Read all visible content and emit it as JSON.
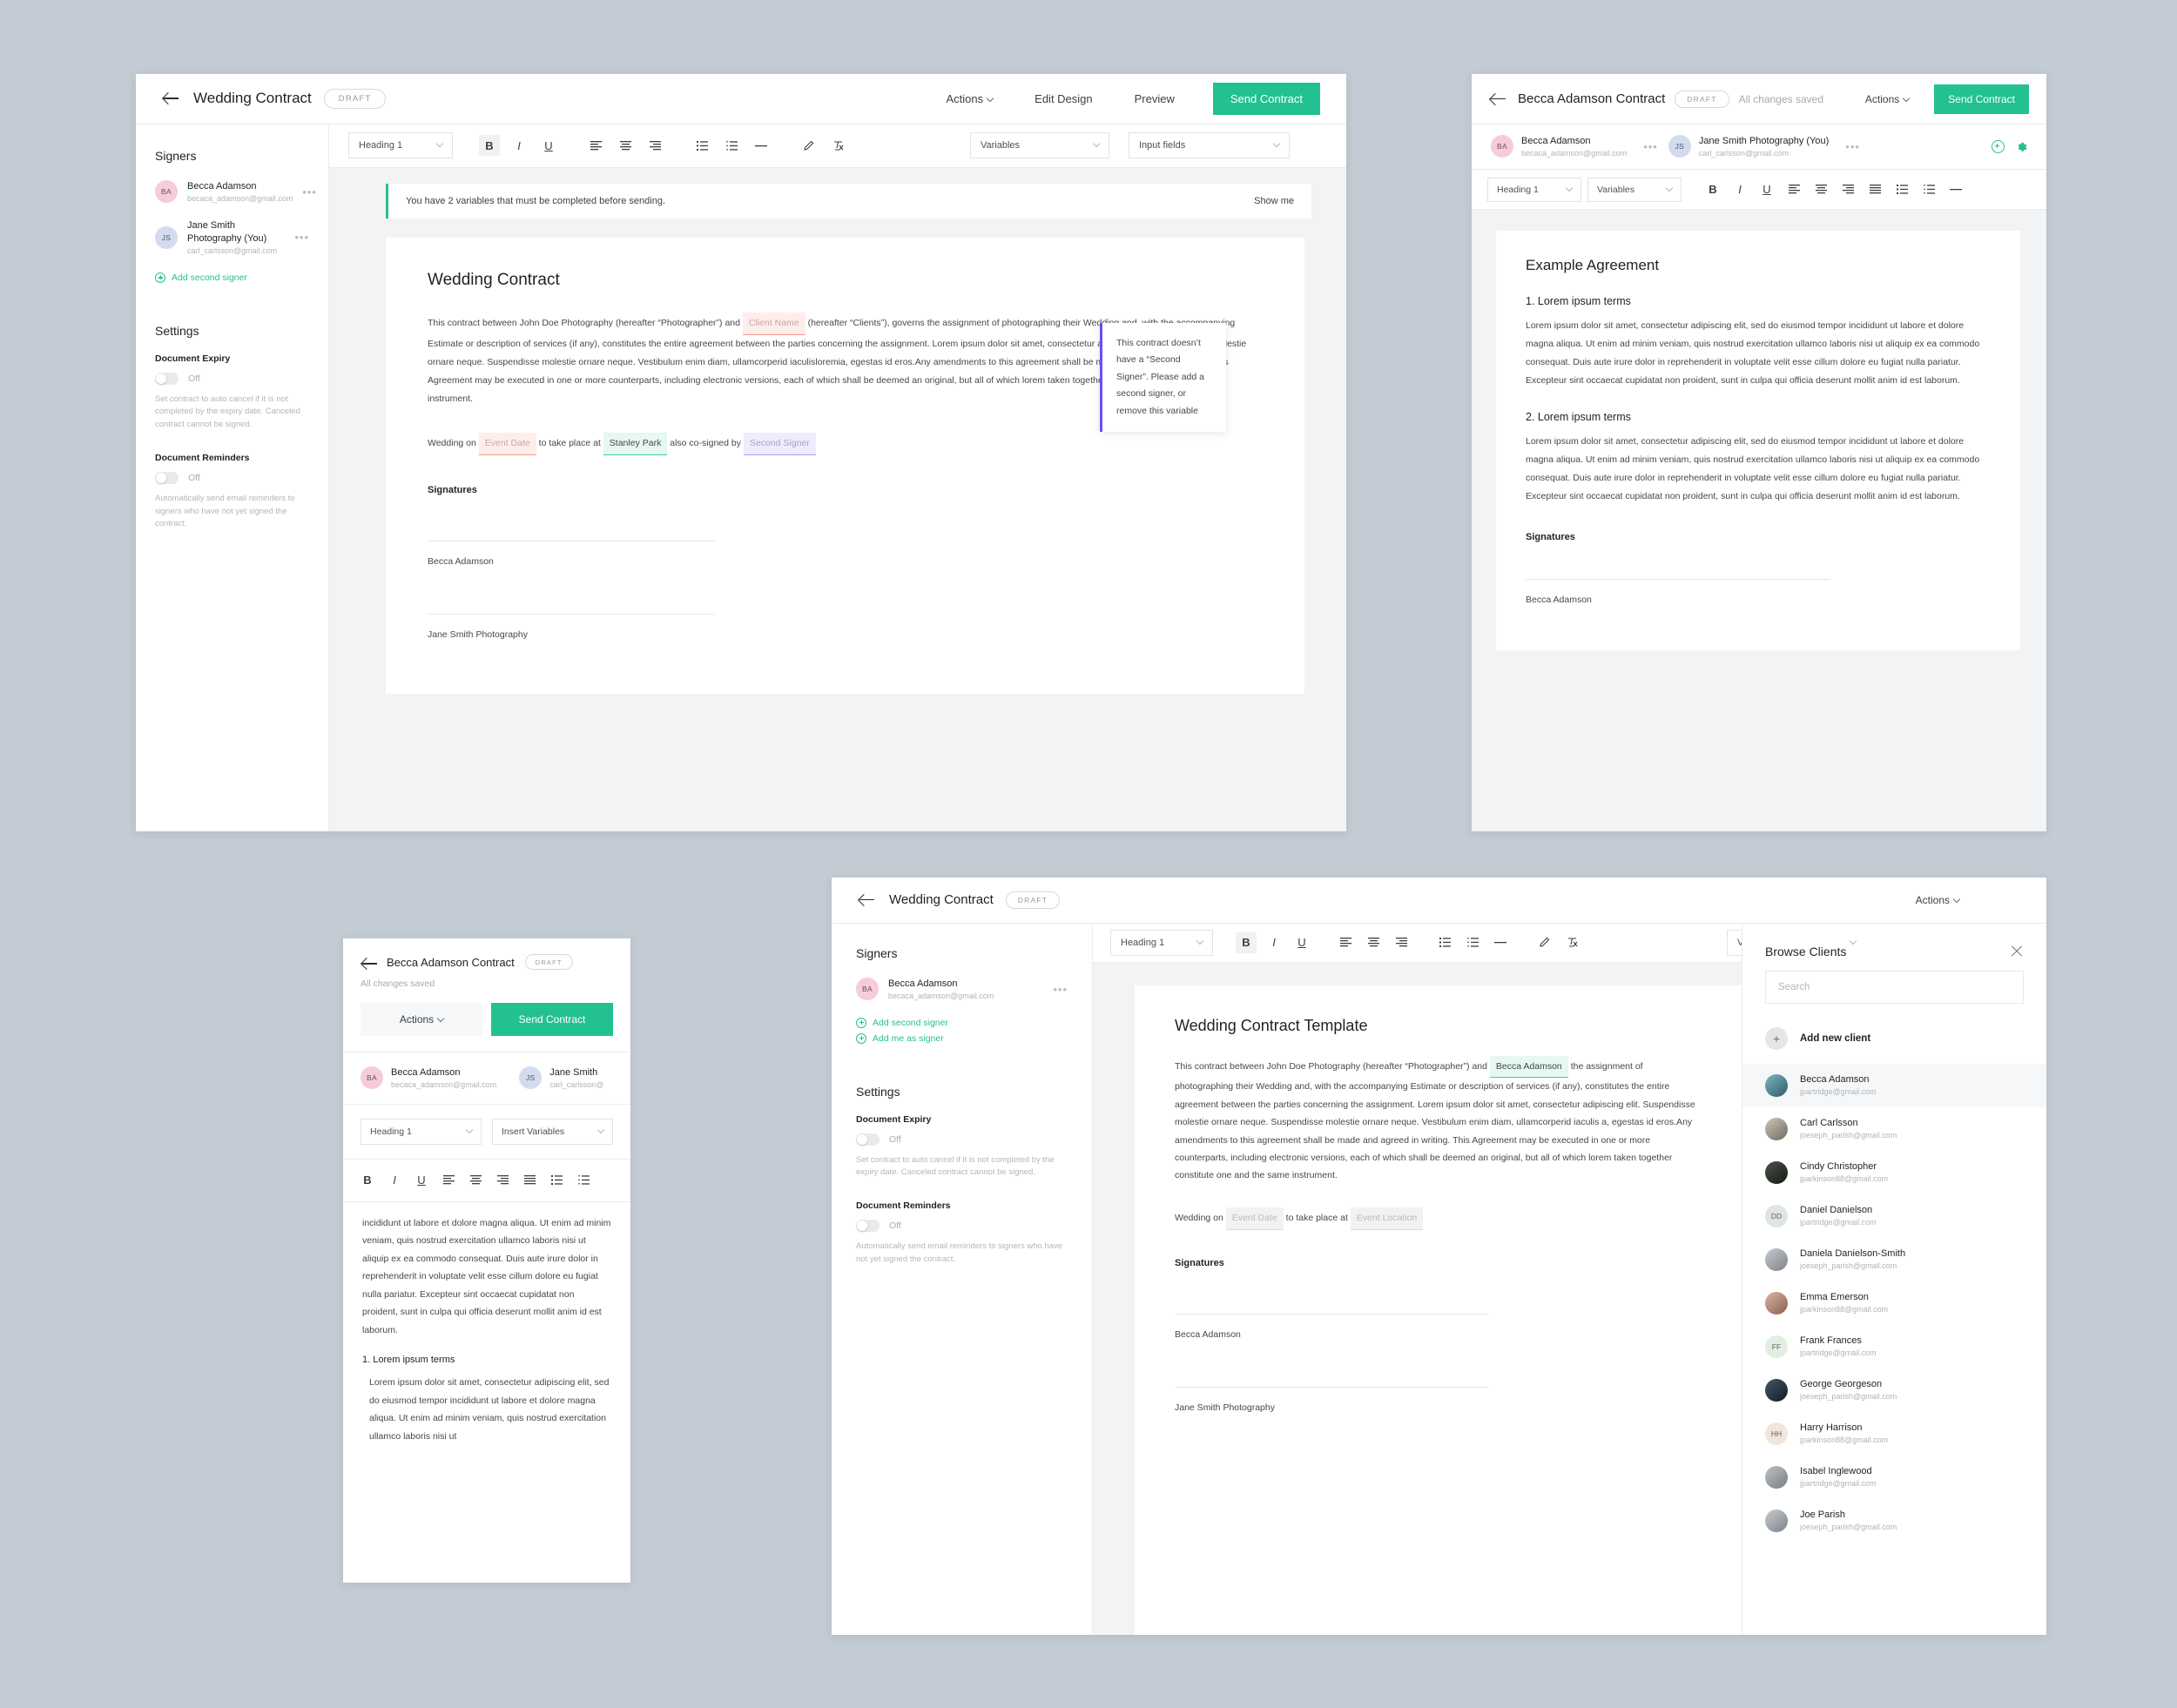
{
  "theme": {
    "accent": "#23c191",
    "page_bg": "#c3cbd4",
    "panel_bg": "#ffffff",
    "tooltip_accent": "#6b4ef5"
  },
  "panel1": {
    "header": {
      "title": "Wedding Contract",
      "status": "DRAFT",
      "actions_label": "Actions",
      "edit_design_label": "Edit Design",
      "preview_label": "Preview",
      "send_label": "Send Contract"
    },
    "sidebar": {
      "signers_heading": "Signers",
      "signers": [
        {
          "initials": "BA",
          "name": "Becca Adamson",
          "email": "becaca_adamson@gmail.com"
        },
        {
          "initials": "JS",
          "name": "Jane Smith Photography (You)",
          "email": "carl_carlsson@gmail.com"
        }
      ],
      "add_second_signer": "Add second signer",
      "settings_heading": "Settings",
      "document_expiry_label": "Document Expiry",
      "document_expiry_state": "Off",
      "document_expiry_desc": "Set contract to auto cancel if it is not completed by the expiry date. Canceled contract cannot be signed.",
      "document_reminders_label": "Document Reminders",
      "document_reminders_state": "Off",
      "document_reminders_desc": "Automatically send email reminders to signers who have not yet signed the contract."
    },
    "toolbar": {
      "heading_select": "Heading 1",
      "variables_select": "Variables",
      "input_fields_select": "Input fields"
    },
    "notice": {
      "text": "You have 2 variables that must be completed before sending.",
      "action": "Show me"
    },
    "doc": {
      "title": "Wedding Contract",
      "para_before_var": "This contract between John Doe Photography (hereafter “Photographer”) and",
      "var_client_name": "Client Name",
      "para_after_var": "(hereafter “Clients”), governs the assignment of photographing their Wedding and, with the accompanying Estimate or description of services (if any), constitutes the entire agreement between the parties concerning the assignment. Lorem ipsum dolor sit amet, consectetur adipiscing elit. Suspendisse molestie ornare neque.  Suspendisse molestie ornare neque. Vestibulum enim diam, ullamcorperid iaculisloremia, egestas id eros.Any amendments to this agreement shall be made and agreed in writing. This Agreement may be executed in one or more counterparts, including electronic versions, each of which shall be deemed an original, but all of which lorem taken together constitute one and the same instrument.",
      "wedding_prefix": "Wedding on",
      "var_event_date": "Event Date",
      "wedding_mid": "to take place at",
      "var_location": "Stanley Park",
      "wedding_suffix": "also co-signed by",
      "var_second_signer": "Second Signer",
      "signatures_heading": "Signatures",
      "sig1": "Becca Adamson",
      "sig2": "Jane Smith Photography"
    },
    "tooltip": "This contract doesn’t have a “Second Signer”. Please add a second signer, or remove this variable"
  },
  "panel2": {
    "header": {
      "title": "Becca Adamson Contract",
      "status": "DRAFT",
      "saved": "All changes saved",
      "actions_label": "Actions",
      "send_label": "Send Contract"
    },
    "signers": [
      {
        "initials": "BA",
        "name": "Becca Adamson",
        "email": "becaca_adamson@gmail.com"
      },
      {
        "initials": "JS",
        "name": "Jane Smith Photography (You)",
        "email": "carl_carlsson@gmail.com"
      }
    ],
    "toolbar": {
      "heading_select": "Heading 1",
      "variables_select": "Variables"
    },
    "doc": {
      "title": "Example Agreement",
      "section1_heading": "1. Lorem ipsum terms",
      "section1_body": "Lorem ipsum dolor sit amet, consectetur adipiscing elit, sed do eiusmod tempor incididunt ut labore et dolore magna aliqua. Ut enim ad minim veniam, quis nostrud exercitation ullamco laboris nisi ut aliquip ex ea commodo consequat. Duis aute irure dolor in reprehenderit in voluptate velit esse cillum dolore eu fugiat nulla pariatur. Excepteur sint occaecat cupidatat non proident, sunt in culpa qui officia deserunt mollit anim id est laborum.",
      "section2_heading": "2. Lorem ipsum terms",
      "section2_body": "Lorem ipsum dolor sit amet, consectetur adipiscing elit, sed do eiusmod tempor incididunt ut labore et dolore magna aliqua. Ut enim ad minim veniam, quis nostrud exercitation ullamco laboris nisi ut aliquip ex ea commodo consequat. Duis aute irure dolor in reprehenderit in voluptate velit esse cillum dolore eu fugiat nulla pariatur. Excepteur sint occaecat cupidatat non proident, sunt in culpa qui officia deserunt mollit anim id est laborum.",
      "signatures_heading": "Signatures",
      "sig1": "Becca Adamson"
    }
  },
  "panel3": {
    "header": {
      "title": "Becca Adamson Contract",
      "status": "DRAFT",
      "saved": "All changes saved"
    },
    "actions_label": "Actions",
    "send_label": "Send Contract",
    "signers": [
      {
        "initials": "BA",
        "name": "Becca Adamson",
        "email": "becaca_adamson@gmail.com"
      },
      {
        "initials": "JS",
        "name": "Jane Smith",
        "email": "carl_carlsson@"
      }
    ],
    "toolbar": {
      "heading_select": "Heading 1",
      "variables_select": "Insert Variables"
    },
    "doc": {
      "body_top": "incididunt ut labore et dolore magna aliqua. Ut enim ad minim veniam, quis nostrud exercitation ullamco laboris nisi ut aliquip ex ea commodo consequat. Duis aute irure dolor in reprehenderit in voluptate velit esse cillum dolore eu fugiat nulla pariatur. Excepteur sint occaecat cupidatat non proident, sunt in culpa qui officia deserunt mollit anim id est laborum.",
      "section1_heading": "1. Lorem ipsum terms",
      "section1_body": "Lorem ipsum dolor sit amet, consectetur adipiscing elit, sed do eiusmod tempor incididunt ut labore et dolore magna aliqua. Ut enim ad minim veniam, quis nostrud exercitation ullamco laboris nisi ut"
    }
  },
  "panel4": {
    "header": {
      "title": "Wedding Contract",
      "status": "DRAFT",
      "actions_label": "Actions"
    },
    "sidebar": {
      "signers_heading": "Signers",
      "signers": [
        {
          "initials": "BA",
          "name": "Becca Adamson",
          "email": "becaca_adamson@gmail.com"
        }
      ],
      "add_second_signer": "Add second signer",
      "add_me_as_signer": "Add me as signer",
      "settings_heading": "Settings",
      "document_expiry_label": "Document Expiry",
      "document_expiry_state": "Off",
      "document_expiry_desc": "Set contract to auto cancel if it is not completed by the expiry date. Canceled contract cannot be signed.",
      "document_reminders_label": "Document Reminders",
      "document_reminders_state": "Off",
      "document_reminders_desc": "Automatically send email reminders to signers who have not yet signed the contract."
    },
    "toolbar": {
      "heading_select": "Heading 1",
      "variables_select": "Variables"
    },
    "doc": {
      "title": "Wedding Contract Template",
      "para_before_var": "This contract between John Doe Photography (hereafter “Photographer”) and",
      "var_client_name": "Becca Adamson",
      "para_after_var": "the assignment of photographing their Wedding and, with the accompanying Estimate or description of services (if any), constitutes the entire agreement between the parties concerning the assignment. Lorem ipsum dolor sit amet, consectetur adipiscing elit. Suspendisse molestie ornare neque.  Suspendisse molestie ornare neque. Vestibulum enim diam, ullamcorperid iaculis a, egestas id eros.Any amendments to this agreement shall be made and agreed in writing. This Agreement may be executed in one or more counterparts, including electronic versions, each of which shall be deemed an original, but all of which lorem taken  together constitute one and the same instrument.",
      "wedding_prefix": "Wedding on",
      "var_event_date": "Event Date",
      "wedding_mid": "to take place at",
      "var_event_location": "Event Location",
      "signatures_heading": "Signatures",
      "sig1": "Becca Adamson",
      "sig2": "Jane Smith Photography"
    }
  },
  "browse_clients": {
    "title": "Browse Clients",
    "search_placeholder": "Search",
    "add_new_client": "Add new client",
    "clients": [
      {
        "name": "Becca Adamson",
        "email": "jpartridge@gmail.com",
        "initials": "",
        "photo": "teal",
        "selected": true
      },
      {
        "name": "Carl Carlsson",
        "email": "joeseph_parish@gmail.com",
        "initials": "",
        "photo": "warm",
        "selected": false
      },
      {
        "name": "Cindy Christopher",
        "email": "jparkinson88@gmail.com",
        "initials": "",
        "photo": "dark",
        "selected": false
      },
      {
        "name": "Daniel Danielson",
        "email": "jpartridge@gmail.com",
        "initials": "DD",
        "photo": "",
        "selected": false
      },
      {
        "name": "Daniela Danielson-Smith",
        "email": "joeseph_parish@gmail.com",
        "initials": "",
        "photo": "grey",
        "selected": false
      },
      {
        "name": "Emma Emerson",
        "email": "jparkinson88@gmail.com",
        "initials": "",
        "photo": "rose",
        "selected": false
      },
      {
        "name": "Frank Frances",
        "email": "jpartridge@gmail.com",
        "initials": "FF",
        "photo": "",
        "selected": false
      },
      {
        "name": "George Georgeson",
        "email": "joeseph_parish@gmail.com",
        "initials": "",
        "photo": "navy",
        "selected": false
      },
      {
        "name": "Harry Harrison",
        "email": "jparkinson88@gmail.com",
        "initials": "HH",
        "photo": "",
        "selected": false
      },
      {
        "name": "Isabel Inglewood",
        "email": "jpartridge@gmail.com",
        "initials": "",
        "photo": "sand",
        "selected": false
      },
      {
        "name": "Joe Parish",
        "email": "joeseph_parish@gmail.com",
        "initials": "",
        "photo": "grey",
        "selected": false
      }
    ]
  },
  "icons": {
    "bold": "B",
    "italic": "I",
    "underline": "U",
    "align_left": "align-left-icon",
    "align_center": "align-center-icon",
    "align_right": "align-right-icon",
    "align_justify": "align-justify-icon",
    "bullet_list": "bullet-list-icon",
    "numbered_list": "numbered-list-icon",
    "horizontal_rule": "horizontal-rule-icon",
    "highlight": "highlighter-icon",
    "clear_format": "clear-format-icon"
  }
}
